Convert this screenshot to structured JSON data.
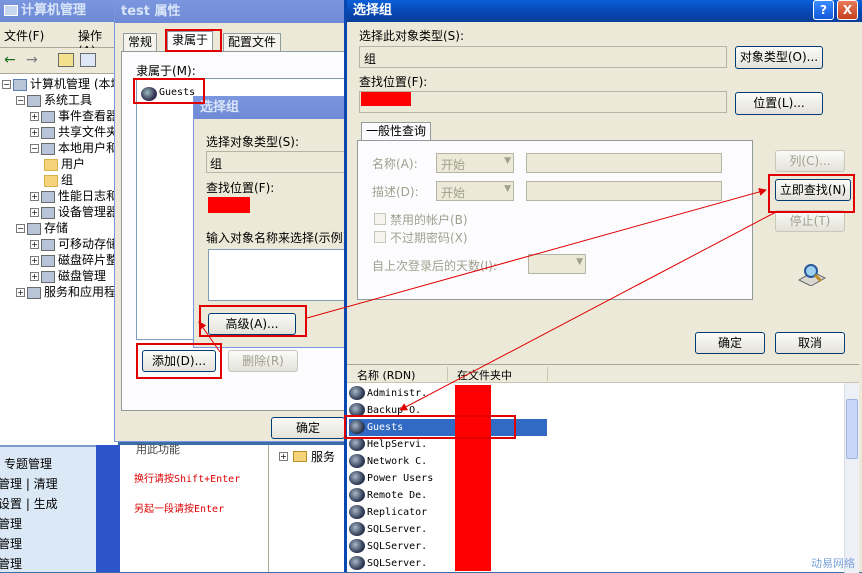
{
  "mmc": {
    "title": "计算机管理",
    "menu": [
      "文件(F)",
      "操作(A)"
    ],
    "tree": [
      {
        "label": "计算机管理 (本地)",
        "level": 0
      },
      {
        "label": "系统工具",
        "level": 1
      },
      {
        "label": "事件查看器",
        "level": 2
      },
      {
        "label": "共享文件夹",
        "level": 2
      },
      {
        "label": "本地用户和组",
        "level": 2
      },
      {
        "label": "用户",
        "level": 3
      },
      {
        "label": "组",
        "level": 3
      },
      {
        "label": "性能日志和警报",
        "level": 2
      },
      {
        "label": "设备管理器",
        "level": 2
      },
      {
        "label": "存储",
        "level": 1
      },
      {
        "label": "可移动存储",
        "level": 2
      },
      {
        "label": "磁盘碎片整理",
        "level": 2
      },
      {
        "label": "磁盘管理",
        "level": 2
      },
      {
        "label": "服务和应用程序",
        "level": 1
      }
    ]
  },
  "props": {
    "title": "test 属性",
    "tabs": [
      "常规",
      "隶属于",
      "配置文件"
    ],
    "member_of_label": "隶属于(M):",
    "members": [
      "Guests"
    ],
    "add_button": "添加(D)...",
    "remove_button": "删除(R)",
    "ok_button": "确定"
  },
  "small_dialog": {
    "title": "选择组",
    "object_type_label": "选择对象类型(S):",
    "object_type_value": "组",
    "location_label": "查找位置(F):",
    "names_label": "输入对象名称来选择(示例)",
    "advanced_button": "高级(A)..."
  },
  "bottom": {
    "left_items": [
      "专题管理",
      "管理 | 清理",
      "设置 | 生成",
      "管理",
      "管理",
      "管理"
    ],
    "hint1": "换行请按Shift+Enter",
    "hint2": "另起一段请按Enter",
    "partial_top": "用此功能",
    "tree_item": "服务"
  },
  "big_dialog": {
    "title": "选择组",
    "help_button": "?",
    "close_button": "X",
    "object_type_label": "选择此对象类型(S):",
    "object_type_value": "组",
    "object_types_button": "对象类型(O)...",
    "location_label": "查找位置(F):",
    "locations_button": "位置(L)...",
    "tab_label": "一般性查询",
    "name_label": "名称(A):",
    "name_mode": "开始",
    "desc_label": "描述(D):",
    "desc_mode": "开始",
    "disabled_accounts": "禁用的帐户(B)",
    "no_expire_pwd": "不过期密码(X)",
    "days_since_logon": "自上次登录后的天数(I):",
    "columns_button": "列(C)...",
    "find_now_button": "立即查找(N)",
    "stop_button": "停止(T)",
    "ok_button": "确定",
    "cancel_button": "取消",
    "results_headers": [
      "名称 (RDN)",
      "在文件夹中"
    ],
    "results": [
      "Administr.",
      "Backup O.",
      "Guests",
      "HelpServi.",
      "Network C.",
      "Power Users",
      "Remote De.",
      "Replicator",
      "SQLServer.",
      "SQLServer.",
      "SQLServer."
    ],
    "selected_index": 2
  },
  "watermark": "动易网络",
  "colors": {
    "xp_blue": "#0846b0",
    "highlight": "#316ac5",
    "redmark": "#ff0000",
    "dialog_bg": "#ece9d8"
  }
}
